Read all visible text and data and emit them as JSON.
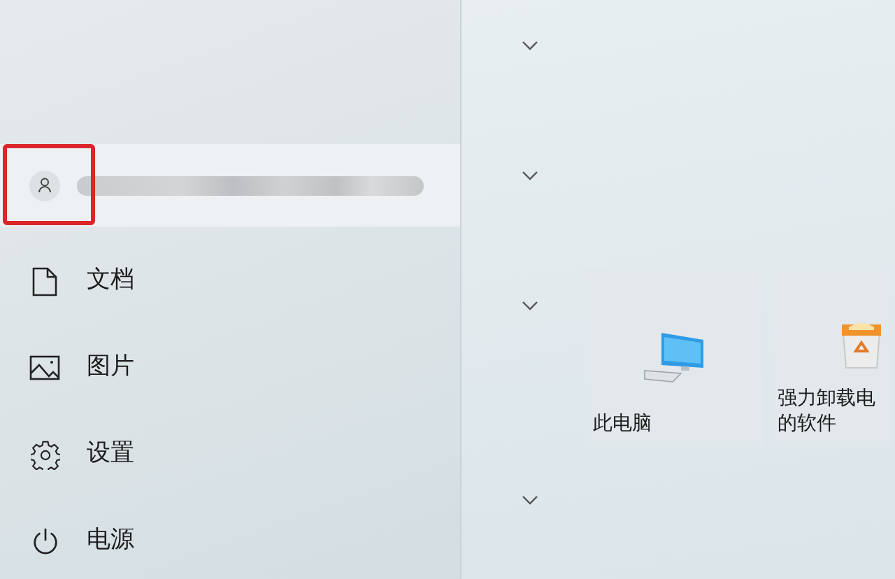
{
  "user": {
    "highlighted": true
  },
  "menu_items": [
    {
      "kind": "document",
      "label": "文档"
    },
    {
      "kind": "pictures",
      "label": "图片"
    },
    {
      "kind": "settings",
      "label": "设置"
    },
    {
      "kind": "power",
      "label": "电源"
    }
  ],
  "tiles": [
    {
      "kind": "computer",
      "lines": [
        "此电脑"
      ]
    },
    {
      "kind": "uninstaller",
      "lines": [
        "强力卸载电",
        "的软件"
      ]
    }
  ]
}
